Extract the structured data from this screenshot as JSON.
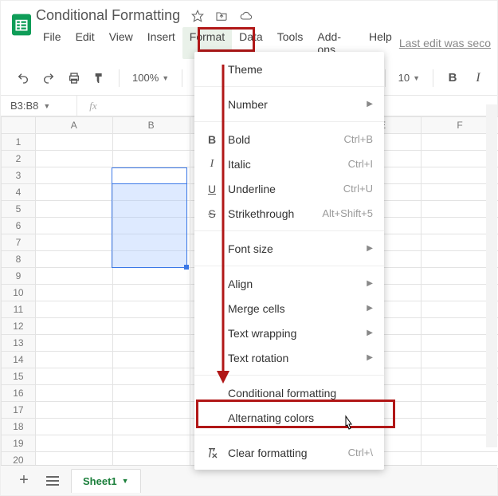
{
  "doc": {
    "title": "Conditional Formatting"
  },
  "menubar": {
    "file": "File",
    "edit": "Edit",
    "view": "View",
    "insert": "Insert",
    "format": "Format",
    "data": "Data",
    "tools": "Tools",
    "addons": "Add-ons",
    "help": "Help",
    "last_edit": "Last edit was seco"
  },
  "toolbar": {
    "zoom": "100%",
    "font_size": "10"
  },
  "namebox": {
    "ref": "B3:B8"
  },
  "columns": [
    "A",
    "B",
    "",
    "",
    "E",
    "F"
  ],
  "rows": [
    "1",
    "2",
    "3",
    "4",
    "5",
    "6",
    "7",
    "8",
    "9",
    "10",
    "11",
    "12",
    "13",
    "14",
    "15",
    "16",
    "17",
    "18",
    "19",
    "20"
  ],
  "format_menu": {
    "theme": "Theme",
    "number": "Number",
    "bold": {
      "label": "Bold",
      "kb": "Ctrl+B"
    },
    "italic": {
      "label": "Italic",
      "kb": "Ctrl+I"
    },
    "underline": {
      "label": "Underline",
      "kb": "Ctrl+U"
    },
    "strike": {
      "label": "Strikethrough",
      "kb": "Alt+Shift+5"
    },
    "font_size": "Font size",
    "align": "Align",
    "merge": "Merge cells",
    "wrap": "Text wrapping",
    "rotate": "Text rotation",
    "cond": "Conditional formatting",
    "alt": "Alternating colors",
    "clear": {
      "label": "Clear formatting",
      "kb": "Ctrl+\\"
    }
  },
  "sheet": {
    "active": "Sheet1"
  }
}
